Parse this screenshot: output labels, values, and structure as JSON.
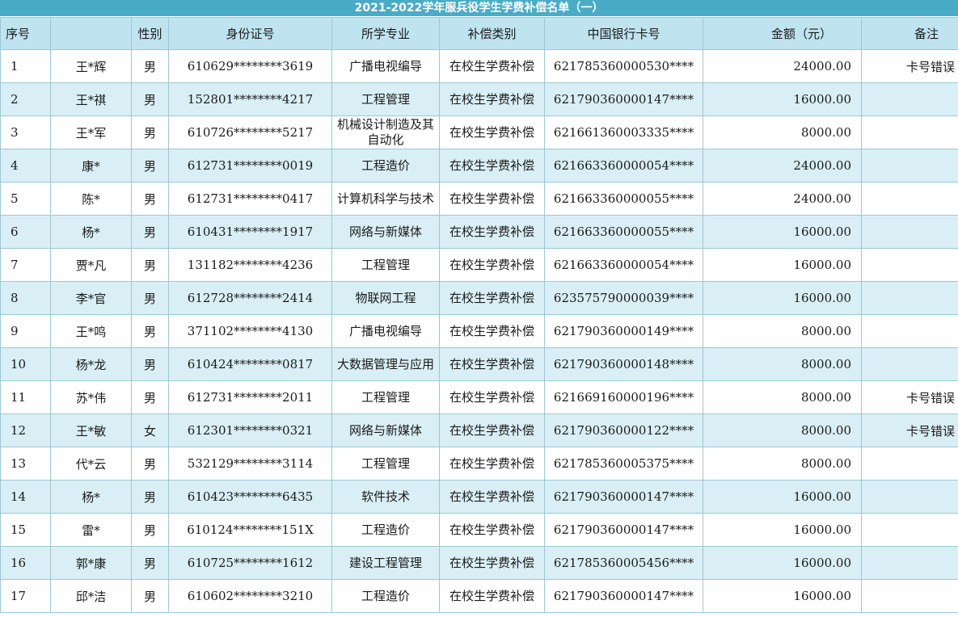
{
  "title": "2021-2022学年服兵役学生学费补偿名单（一）",
  "headers": {
    "no": "序号",
    "name": "",
    "sex": "性别",
    "id": "身份证号",
    "major": "所学专业",
    "type": "补偿类别",
    "card": "中国银行卡号",
    "amount": "金额（元）",
    "note": "备注"
  },
  "rows": [
    {
      "no": "1",
      "name": "王*辉",
      "sex": "男",
      "id": "610629********3619",
      "major": "广播电视编导",
      "type": "在校生学费补偿",
      "card": "621785360000530****",
      "amount": "24000.00",
      "note": "卡号错误"
    },
    {
      "no": "2",
      "name": "王*祺",
      "sex": "男",
      "id": "152801********4217",
      "major": "工程管理",
      "type": "在校生学费补偿",
      "card": "621790360000147****",
      "amount": "16000.00",
      "note": ""
    },
    {
      "no": "3",
      "name": "王*军",
      "sex": "男",
      "id": "610726********5217",
      "major": "机械设计制造及其自动化",
      "type": "在校生学费补偿",
      "card": "621661360003335****",
      "amount": "8000.00",
      "note": ""
    },
    {
      "no": "4",
      "name": "康*",
      "sex": "男",
      "id": "612731********0019",
      "major": "工程造价",
      "type": "在校生学费补偿",
      "card": "621663360000054****",
      "amount": "24000.00",
      "note": ""
    },
    {
      "no": "5",
      "name": "陈*",
      "sex": "男",
      "id": "612731********0417",
      "major": "计算机科学与技术",
      "type": "在校生学费补偿",
      "card": "621663360000055****",
      "amount": "24000.00",
      "note": ""
    },
    {
      "no": "6",
      "name": "杨*",
      "sex": "男",
      "id": "610431********1917",
      "major": "网络与新媒体",
      "type": "在校生学费补偿",
      "card": "621663360000055****",
      "amount": "16000.00",
      "note": ""
    },
    {
      "no": "7",
      "name": "贾*凡",
      "sex": "男",
      "id": "131182********4236",
      "major": "工程管理",
      "type": "在校生学费补偿",
      "card": "621663360000054****",
      "amount": "16000.00",
      "note": ""
    },
    {
      "no": "8",
      "name": "李*官",
      "sex": "男",
      "id": "612728********2414",
      "major": "物联网工程",
      "type": "在校生学费补偿",
      "card": "623575790000039****",
      "amount": "16000.00",
      "note": ""
    },
    {
      "no": "9",
      "name": "王*鸣",
      "sex": "男",
      "id": "371102********4130",
      "major": "广播电视编导",
      "type": "在校生学费补偿",
      "card": "621790360000149****",
      "amount": "8000.00",
      "note": ""
    },
    {
      "no": "10",
      "name": "杨*龙",
      "sex": "男",
      "id": "610424********0817",
      "major": "大数据管理与应用",
      "type": "在校生学费补偿",
      "card": "621790360000148****",
      "amount": "8000.00",
      "note": ""
    },
    {
      "no": "11",
      "name": "苏*伟",
      "sex": "男",
      "id": "612731********2011",
      "major": "工程管理",
      "type": "在校生学费补偿",
      "card": "621669160000196****",
      "amount": "8000.00",
      "note": "卡号错误"
    },
    {
      "no": "12",
      "name": "王*敏",
      "sex": "女",
      "id": "612301********0321",
      "major": "网络与新媒体",
      "type": "在校生学费补偿",
      "card": "621790360000122****",
      "amount": "8000.00",
      "note": "卡号错误"
    },
    {
      "no": "13",
      "name": "代*云",
      "sex": "男",
      "id": "532129********3114",
      "major": "工程管理",
      "type": "在校生学费补偿",
      "card": "621785360005375****",
      "amount": "8000.00",
      "note": ""
    },
    {
      "no": "14",
      "name": "杨*",
      "sex": "男",
      "id": "610423********6435",
      "major": "软件技术",
      "type": "在校生学费补偿",
      "card": "621790360000147****",
      "amount": "16000.00",
      "note": ""
    },
    {
      "no": "15",
      "name": "雷*",
      "sex": "男",
      "id": "610124********151X",
      "major": "工程造价",
      "type": "在校生学费补偿",
      "card": "621790360000147****",
      "amount": "16000.00",
      "note": ""
    },
    {
      "no": "16",
      "name": "郭*康",
      "sex": "男",
      "id": "610725********1612",
      "major": "建设工程管理",
      "type": "在校生学费补偿",
      "card": "621785360005456****",
      "amount": "16000.00",
      "note": ""
    },
    {
      "no": "17",
      "name": "邱*洁",
      "sex": "男",
      "id": "610602********3210",
      "major": "工程造价",
      "type": "在校生学费补偿",
      "card": "621790360000147****",
      "amount": "16000.00",
      "note": ""
    }
  ]
}
